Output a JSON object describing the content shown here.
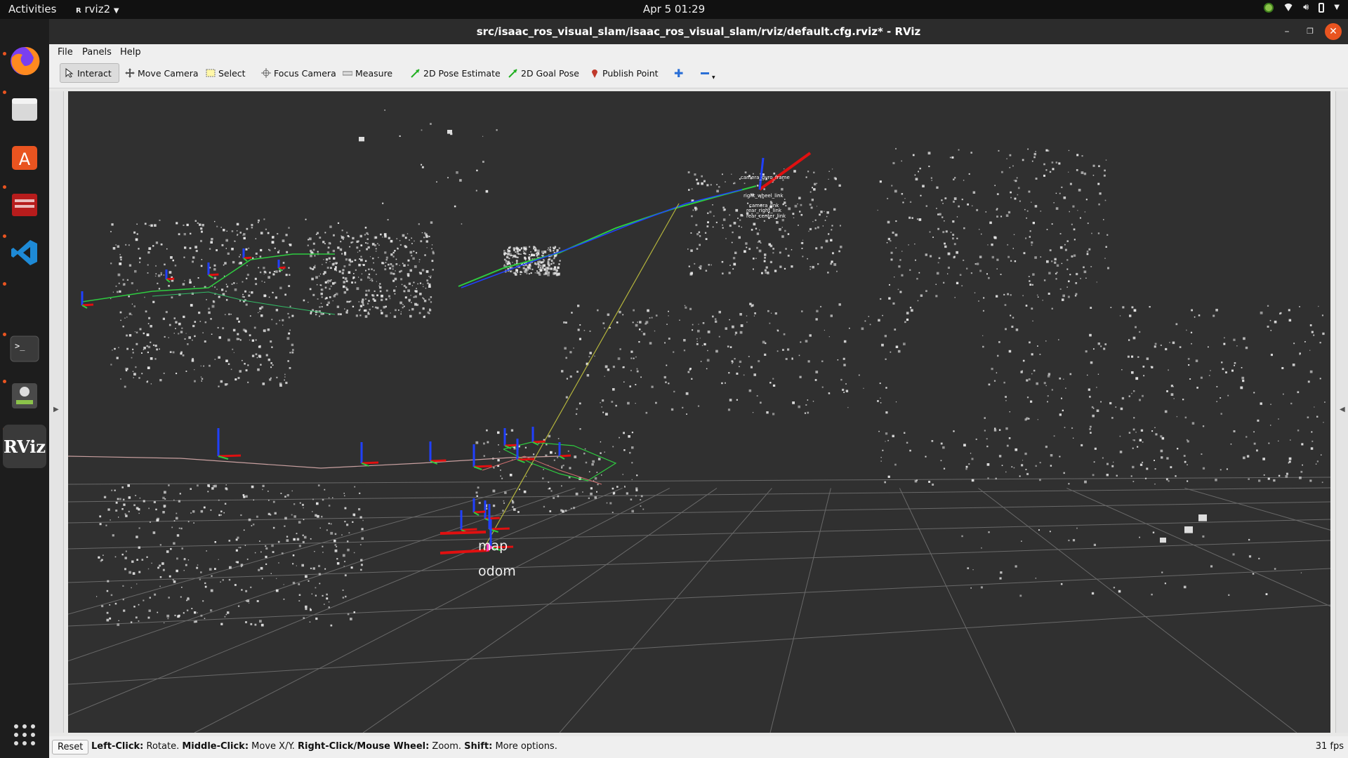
{
  "topbar": {
    "activities": "Activities",
    "app_menu": "rviz2",
    "clock": "Apr 5  01:29"
  },
  "dock": {
    "apps": [
      "firefox-icon",
      "files-icon",
      "software-icon",
      "app-red-icon",
      "vscode-icon",
      "terminal-icon",
      "robot-app-icon",
      "rviz-icon",
      "show-apps-icon"
    ],
    "rviz_label": "RViz"
  },
  "window": {
    "title": "src/isaac_ros_visual_slam/isaac_ros_visual_slam/rviz/default.cfg.rviz* - RViz"
  },
  "menu": {
    "file": "File",
    "panels": "Panels",
    "help": "Help"
  },
  "toolbar": {
    "interact": "Interact",
    "move_camera": "Move Camera",
    "select": "Select",
    "focus_camera": "Focus Camera",
    "measure": "Measure",
    "pose_estimate": "2D Pose Estimate",
    "goal_pose": "2D Goal Pose",
    "publish_point": "Publish Point"
  },
  "view": {
    "frame_map": "map",
    "frame_odom": "odom",
    "tf_labels": [
      "camera_gyro_frame",
      "right_wheel_link",
      "camera_link",
      "rear_right_link",
      "rear_center_link"
    ]
  },
  "status": {
    "reset": "Reset",
    "help_1b": "Left-Click:",
    "help_1": " Rotate. ",
    "help_2b": "Middle-Click:",
    "help_2": " Move X/Y. ",
    "help_3b": "Right-Click/Mouse Wheel:",
    "help_3": " Zoom. ",
    "help_4b": "Shift:",
    "help_4": " More options.",
    "fps": "31 fps"
  },
  "colors": {
    "background": "#303030",
    "grid": "#8a8a8a",
    "path_green": "#2ecc40",
    "path_blue": "#2040ff",
    "axis_red": "#e01010",
    "points": "#e8e8e8"
  }
}
